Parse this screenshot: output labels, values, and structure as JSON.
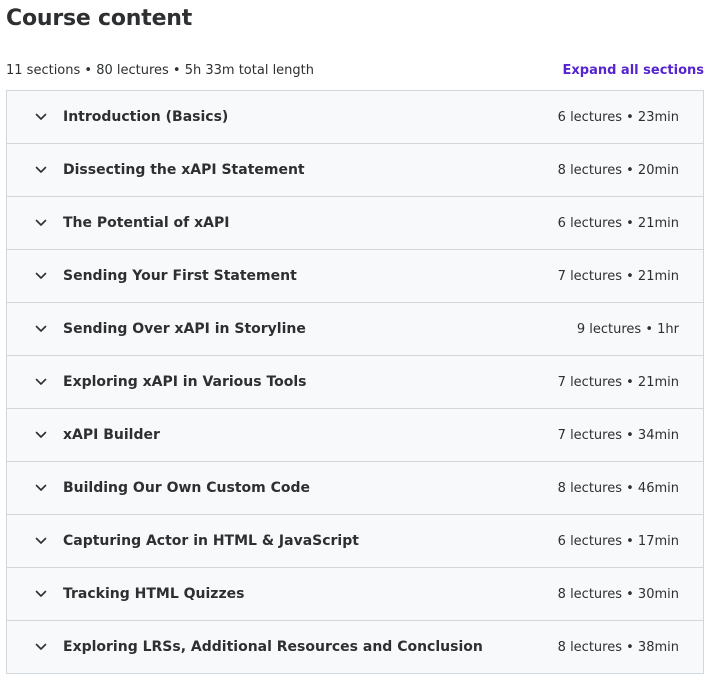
{
  "page": {
    "title": "Course content"
  },
  "summary": {
    "text": "11 sections • 80 lectures • 5h 33m total length",
    "expand_all_label": "Expand all sections"
  },
  "icons": {
    "section_toggle": "chevron-down-icon"
  },
  "colors": {
    "accent": "#5624d0",
    "row_background": "#f7f9fa",
    "border": "#d1d7dc",
    "text": "#2d2f31"
  },
  "sections": [
    {
      "title": "Introduction (Basics)",
      "meta": "6 lectures • 23min"
    },
    {
      "title": "Dissecting the xAPI Statement",
      "meta": "8 lectures • 20min"
    },
    {
      "title": "The Potential of xAPI",
      "meta": "6 lectures • 21min"
    },
    {
      "title": "Sending Your First Statement",
      "meta": "7 lectures • 21min"
    },
    {
      "title": "Sending Over xAPI in Storyline",
      "meta": "9 lectures • 1hr"
    },
    {
      "title": "Exploring xAPI in Various Tools",
      "meta": "7 lectures • 21min"
    },
    {
      "title": "xAPI Builder",
      "meta": "7 lectures • 34min"
    },
    {
      "title": "Building Our Own Custom Code",
      "meta": "8 lectures • 46min"
    },
    {
      "title": "Capturing Actor in HTML & JavaScript",
      "meta": "6 lectures • 17min"
    },
    {
      "title": "Tracking HTML Quizzes",
      "meta": "8 lectures • 30min"
    },
    {
      "title": "Exploring LRSs, Additional Resources and Conclusion",
      "meta": "8 lectures • 38min"
    }
  ]
}
